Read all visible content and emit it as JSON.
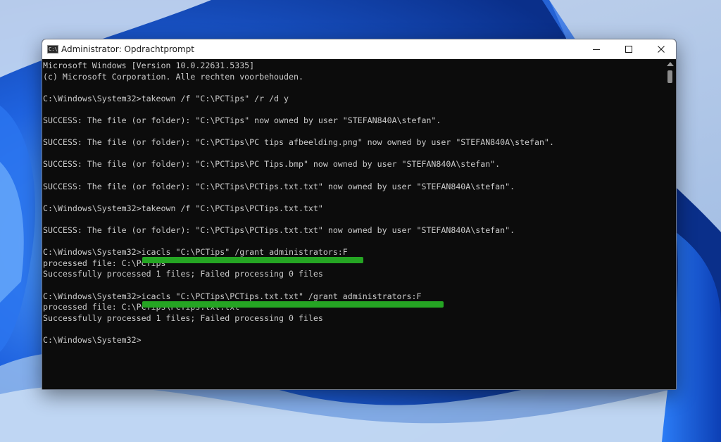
{
  "window": {
    "title": "Administrator: Opdrachtprompt",
    "icon_text": "C:\\",
    "controls": [
      "minimize-icon",
      "maximize-icon",
      "close-icon"
    ]
  },
  "console": {
    "lines": [
      "Microsoft Windows [Version 10.0.22631.5335]",
      "(c) Microsoft Corporation. Alle rechten voorbehouden.",
      "",
      "C:\\Windows\\System32>takeown /f \"C:\\PCTips\" /r /d y",
      "",
      "SUCCESS: The file (or folder): \"C:\\PCTips\" now owned by user \"STEFAN840A\\stefan\".",
      "",
      "SUCCESS: The file (or folder): \"C:\\PCTips\\PC tips afbeelding.png\" now owned by user \"STEFAN840A\\stefan\".",
      "",
      "SUCCESS: The file (or folder): \"C:\\PCTips\\PC Tips.bmp\" now owned by user \"STEFAN840A\\stefan\".",
      "",
      "SUCCESS: The file (or folder): \"C:\\PCTips\\PCTips.txt.txt\" now owned by user \"STEFAN840A\\stefan\".",
      "",
      "C:\\Windows\\System32>takeown /f \"C:\\PCTips\\PCTips.txt.txt\"",
      "",
      "SUCCESS: The file (or folder): \"C:\\PCTips\\PCTips.txt.txt\" now owned by user \"STEFAN840A\\stefan\".",
      "",
      "C:\\Windows\\System32>icacls \"C:\\PCTips\" /grant administrators:F",
      "processed file: C:\\PCTips",
      "Successfully processed 1 files; Failed processing 0 files",
      "",
      "C:\\Windows\\System32>icacls \"C:\\PCTips\\PCTips.txt.txt\" /grant administrators:F",
      "processed file: C:\\PCTips\\PCTips.txt.txt",
      "Successfully processed 1 files; Failed processing 0 files",
      "",
      "C:\\Windows\\System32>"
    ]
  },
  "colors": {
    "console_bg": "#0c0c0c",
    "console_text": "#cccccc",
    "highlight": "#25a523",
    "wallpaper": "#0a3a9e"
  }
}
